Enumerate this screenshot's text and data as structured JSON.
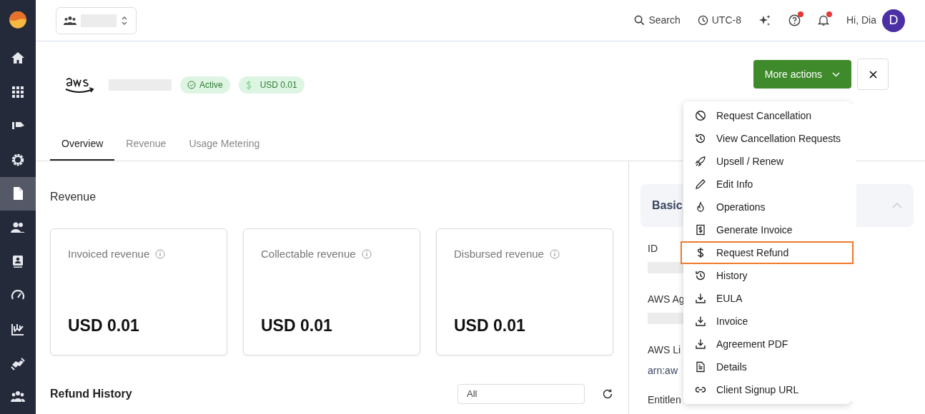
{
  "sidebar": {
    "items": [
      {
        "selected": false
      },
      {
        "selected": false
      },
      {
        "selected": false
      },
      {
        "selected": false
      },
      {
        "selected": true
      },
      {
        "selected": false
      },
      {
        "selected": false
      },
      {
        "selected": false
      },
      {
        "selected": false
      },
      {
        "selected": false
      },
      {
        "selected": false
      }
    ]
  },
  "topbar": {
    "search": "Search",
    "timezone": "UTC-8",
    "help_alert": true,
    "notification_alert": true,
    "greeting": "Hi, Dia",
    "avatar": "D"
  },
  "header": {
    "status": "Active",
    "amount": "USD 0.01",
    "more_actions": "More actions"
  },
  "tabs": [
    {
      "label": "Overview",
      "selected": true
    },
    {
      "label": "Revenue",
      "selected": false
    },
    {
      "label": "Usage Metering",
      "selected": false
    }
  ],
  "revenue": {
    "title": "Revenue",
    "cards": [
      {
        "label": "Invoiced revenue",
        "value": "USD 0.01"
      },
      {
        "label": "Collectable revenue",
        "value": "USD 0.01"
      },
      {
        "label": "Disbursed revenue",
        "value": "USD 0.01"
      }
    ]
  },
  "refund_history": {
    "title": "Refund History",
    "filter": "All"
  },
  "basic_panel": {
    "title": "Basic",
    "fields": [
      {
        "label": "ID",
        "kind": "redacted"
      },
      {
        "label": "AWS Ag",
        "kind": "redacted"
      },
      {
        "label": "AWS Li",
        "kind": "link",
        "value": "arn:aw"
      },
      {
        "label": "Entitlen",
        "kind": "none"
      }
    ]
  },
  "menu": [
    {
      "label": "Request Cancellation",
      "selected": false
    },
    {
      "label": "View Cancellation Requests",
      "selected": false
    },
    {
      "label": "Upsell / Renew",
      "selected": false
    },
    {
      "label": "Edit Info",
      "selected": false
    },
    {
      "label": "Operations",
      "selected": false
    },
    {
      "label": "Generate Invoice",
      "selected": false
    },
    {
      "label": "Request Refund",
      "selected": true
    },
    {
      "label": "History",
      "selected": false
    },
    {
      "label": "EULA",
      "selected": false
    },
    {
      "label": "Invoice",
      "selected": false
    },
    {
      "label": "Agreement PDF",
      "selected": false
    },
    {
      "label": "Details",
      "selected": false
    },
    {
      "label": "Client Signup URL",
      "selected": false
    }
  ]
}
